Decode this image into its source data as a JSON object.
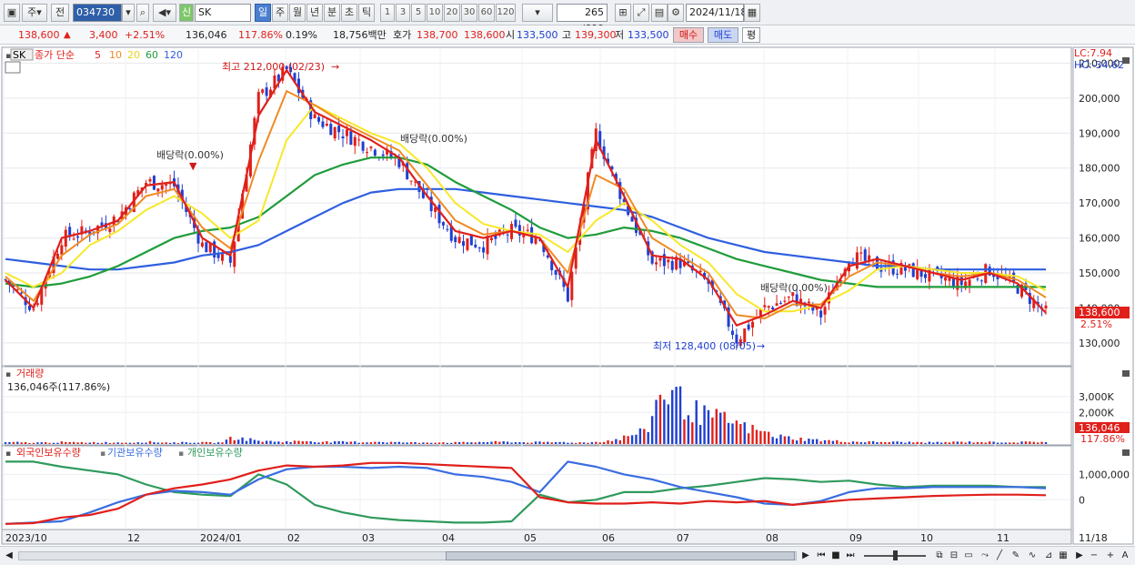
{
  "toolbar": {
    "period_primary": "주",
    "period_prev": "전",
    "stock_code": "034730",
    "stock_name": "SK",
    "market_badge": "신",
    "period_tabs": [
      "일",
      "주",
      "월",
      "년",
      "분",
      "초",
      "틱"
    ],
    "active_period": "일",
    "interval_tabs": [
      "1",
      "3",
      "5",
      "10",
      "20",
      "30",
      "60",
      "120"
    ],
    "count_display": "265 /600",
    "date": "2024/11/18"
  },
  "quote": {
    "price": "138,600",
    "direction_icon": "▲",
    "change": "3,400",
    "change_pct": "+2.51%",
    "volume": "136,046",
    "volume_ratio": "117.86%",
    "turnover": "0.19%",
    "amount": "18,756백만",
    "bid_ask_label": "호가",
    "bid": "138,700",
    "ask": "138,600",
    "open_label": "시",
    "open": "133,500",
    "high_label": "고",
    "high": "139,300",
    "low_label": "저",
    "low": "133,500",
    "buy_label": "매수",
    "sell_label": "매도",
    "eval_label": "평"
  },
  "main_panel": {
    "stock_tag": "SK",
    "legend_prefix": "종가 단순",
    "ma_periods": [
      "5",
      "10",
      "20",
      "60",
      "120"
    ],
    "lc": "LC:7.94",
    "hc": "HC:-34.62",
    "high_annotation": "최고 212,000 (02/23)",
    "low_annotation": "최저 128,400 (08/05)",
    "dividend_annotations": [
      "배당락(0.00%)",
      "배당락(0.00%)",
      "배당락(0.00%)"
    ],
    "price_label": "138,600",
    "pct_label": "2.51%"
  },
  "volume_panel": {
    "title": "거래량",
    "value_text": "136,046주(117.86%)",
    "last_label": "136,046",
    "ratio_label": "117.86%"
  },
  "holding_panel": {
    "series_labels": [
      "외국인보유수량",
      "기관보유수량",
      "개인보유수량"
    ]
  },
  "x_axis": {
    "labels": [
      "2023/10",
      "12",
      "2024/01",
      "02",
      "03",
      "04",
      "05",
      "06",
      "07",
      "08",
      "09",
      "10",
      "11"
    ],
    "right_label": "11/18"
  },
  "colors": {
    "ma5": "#e0201b",
    "ma10": "#f08a24",
    "ma20": "#f7e82a",
    "ma60": "#1f9c3a",
    "ma120": "#2f5fe0",
    "up_candle": "#e0201b",
    "down_candle": "#1f3fd1",
    "foreign": "#e0201b",
    "institution": "#3a6de0",
    "individual": "#2f9a5c"
  },
  "chart_data": [
    {
      "type": "candlestick",
      "title": "SK 일봉",
      "y_ticks": [
        "130,000",
        "140,000",
        "150,000",
        "160,000",
        "170,000",
        "180,000",
        "190,000",
        "200,000",
        "210,000"
      ],
      "ylim": [
        124000,
        214000
      ],
      "x_categories": [
        "2023/10",
        "12",
        "2024/01",
        "02",
        "03",
        "04",
        "05",
        "06",
        "07",
        "08",
        "09",
        "10",
        "11"
      ],
      "series": [
        {
          "name": "5",
          "values": [
            148000,
            140000,
            160000,
            162000,
            165000,
            175000,
            176000,
            160000,
            155000,
            195000,
            208000,
            196000,
            192000,
            188000,
            183000,
            172000,
            162000,
            160000,
            162000,
            160000,
            146000,
            188000,
            172000,
            155000,
            154000,
            148000,
            135000,
            138000,
            142000,
            140000,
            152000,
            154000,
            152000,
            150000,
            148000,
            150000,
            147000,
            138600
          ]
        },
        {
          "name": "10",
          "values": [
            149000,
            142000,
            155000,
            161000,
            164000,
            172000,
            174000,
            163000,
            157000,
            182000,
            202000,
            198000,
            193000,
            189000,
            185000,
            175000,
            165000,
            161000,
            162000,
            160000,
            150000,
            178000,
            174000,
            160000,
            155000,
            150000,
            138000,
            137000,
            141000,
            141000,
            149000,
            153000,
            152000,
            150000,
            149000,
            150000,
            148000,
            143000
          ]
        },
        {
          "name": "20",
          "values": [
            150000,
            146000,
            150000,
            158000,
            162000,
            168000,
            172000,
            167000,
            160000,
            165000,
            188000,
            198000,
            194000,
            190000,
            187000,
            180000,
            170000,
            164000,
            162000,
            161000,
            156000,
            165000,
            170000,
            165000,
            158000,
            153000,
            144000,
            139000,
            139000,
            141000,
            145000,
            151000,
            152000,
            151000,
            150000,
            150000,
            149000,
            145000
          ]
        },
        {
          "name": "60",
          "values": [
            147000,
            146000,
            147000,
            149000,
            152000,
            156000,
            160000,
            162000,
            163000,
            166000,
            172000,
            178000,
            181000,
            183000,
            183000,
            181000,
            176000,
            172000,
            168000,
            163000,
            160000,
            161000,
            163000,
            162000,
            160000,
            157000,
            154000,
            152000,
            150000,
            148000,
            147000,
            146000,
            146000,
            146000,
            146000,
            146000,
            146000,
            146000
          ]
        },
        {
          "name": "120",
          "values": [
            154000,
            153000,
            152000,
            151000,
            151000,
            152000,
            153000,
            155000,
            156000,
            158000,
            162000,
            166000,
            170000,
            173000,
            174000,
            174000,
            174000,
            173000,
            172000,
            171000,
            170000,
            169000,
            168000,
            166000,
            163000,
            160000,
            158000,
            156000,
            155000,
            154000,
            153000,
            152000,
            152000,
            151000,
            151000,
            151000,
            151000,
            151000
          ]
        }
      ],
      "close": [
        148000,
        140000,
        160000,
        162000,
        166000,
        176000,
        175000,
        158000,
        153000,
        200000,
        208000,
        194000,
        190000,
        186000,
        182000,
        170000,
        160000,
        158000,
        162000,
        160000,
        143000,
        190000,
        170000,
        153000,
        153000,
        147000,
        131000,
        140000,
        143000,
        138000,
        155000,
        152000,
        151000,
        149000,
        147000,
        151000,
        146000,
        138600
      ]
    },
    {
      "type": "bar",
      "title": "거래량",
      "y_ticks": [
        "2,000K",
        "3,000K"
      ],
      "ylim": [
        0,
        3800
      ],
      "values": [
        90,
        110,
        80,
        100,
        120,
        90,
        110,
        100,
        95,
        105,
        140,
        100,
        90,
        110,
        95,
        85,
        400,
        300,
        180,
        160,
        150,
        200,
        150,
        120,
        140,
        110,
        150,
        120,
        100,
        90,
        110,
        100,
        95,
        120,
        130,
        140,
        110,
        115,
        105,
        120,
        90,
        100,
        180,
        300,
        600,
        800,
        3400,
        3000,
        2200,
        1800,
        1600,
        1400,
        1000,
        800,
        500,
        400,
        300,
        250,
        200,
        150,
        140,
        130,
        130,
        120,
        110,
        100,
        110,
        130,
        130,
        120,
        120,
        110,
        130,
        136
      ]
    },
    {
      "type": "line",
      "title": "보유수량",
      "y_ticks": [
        "0",
        "1,000,000"
      ],
      "ylim": [
        -1100000,
        1550000
      ],
      "series": [
        {
          "name": "외국인보유수량",
          "values": [
            -950000,
            -920000,
            -700000,
            -600000,
            -350000,
            200000,
            450000,
            600000,
            800000,
            1150000,
            1350000,
            1300000,
            1350000,
            1450000,
            1450000,
            1400000,
            1350000,
            1300000,
            1250000,
            100000,
            -100000,
            -150000,
            -150000,
            -100000,
            -150000,
            -50000,
            -100000,
            -50000,
            -200000,
            -100000,
            0,
            50000,
            100000,
            150000,
            180000,
            200000,
            200000,
            180000
          ]
        },
        {
          "name": "기관보유수량",
          "values": [
            -950000,
            -900000,
            -850000,
            -500000,
            -100000,
            200000,
            350000,
            300000,
            200000,
            800000,
            1200000,
            1300000,
            1300000,
            1250000,
            1300000,
            1250000,
            1000000,
            900000,
            700000,
            300000,
            1500000,
            1300000,
            1000000,
            800000,
            500000,
            300000,
            100000,
            -150000,
            -200000,
            -50000,
            300000,
            450000,
            450000,
            500000,
            500000,
            500000,
            500000,
            450000
          ]
        },
        {
          "name": "개인보유수량",
          "values": [
            1500000,
            1500000,
            1300000,
            1150000,
            1000000,
            600000,
            300000,
            200000,
            150000,
            1000000,
            600000,
            -200000,
            -500000,
            -700000,
            -800000,
            -850000,
            -900000,
            -900000,
            -850000,
            200000,
            -100000,
            0,
            300000,
            300000,
            450000,
            550000,
            700000,
            850000,
            800000,
            700000,
            750000,
            600000,
            500000,
            550000,
            550000,
            550000,
            500000,
            500000
          ]
        }
      ]
    }
  ]
}
